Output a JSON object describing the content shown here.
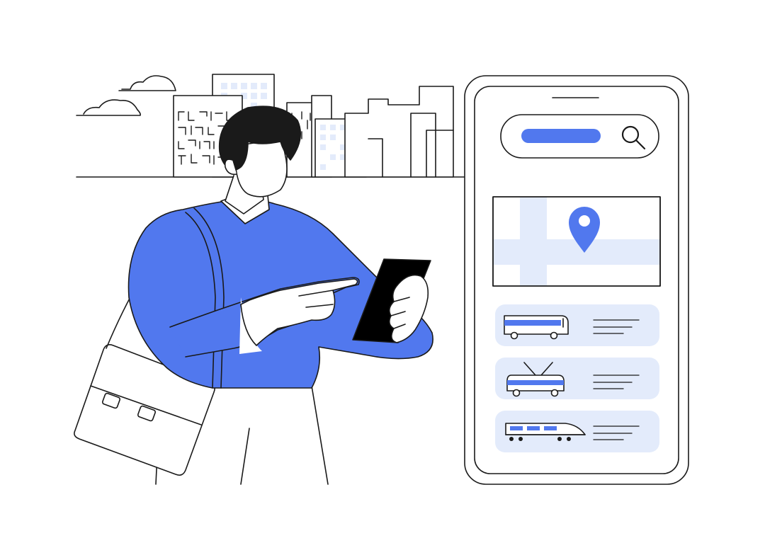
{
  "colors": {
    "background": "#ffffff",
    "outline": "#1a1a1a",
    "accent_blue": "#5178ee",
    "light_blue": "#e3ebfb",
    "phone_screen_dark": "#000000"
  },
  "search": {
    "icon": "magnifier-icon"
  },
  "map": {
    "pin_icon": "location-pin-icon"
  },
  "transport_options": [
    {
      "icon": "bus-icon"
    },
    {
      "icon": "trolleybus-icon"
    },
    {
      "icon": "train-icon"
    }
  ]
}
